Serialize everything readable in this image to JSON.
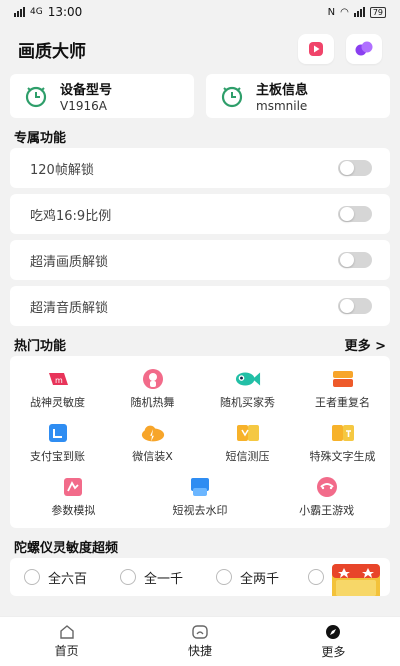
{
  "status_bar": {
    "carrier": "4G",
    "time": "13:00",
    "battery": "79"
  },
  "header": {
    "title": "画质大师"
  },
  "device_cards": [
    {
      "label": "设备型号",
      "value": "V1916A"
    },
    {
      "label": "主板信息",
      "value": "msmnile"
    }
  ],
  "exclusive": {
    "title": "专属功能",
    "items": [
      {
        "label": "120帧解锁",
        "enabled": false
      },
      {
        "label": "吃鸡16:9比例",
        "enabled": false
      },
      {
        "label": "超清画质解锁",
        "enabled": false
      },
      {
        "label": "超清音质解锁",
        "enabled": false
      }
    ]
  },
  "hot": {
    "title": "热门功能",
    "more": "更多 >",
    "items": [
      {
        "label": "战神灵敏度",
        "icon": "game-controller-icon"
      },
      {
        "label": "随机热舞",
        "icon": "dancer-icon"
      },
      {
        "label": "随机买家秀",
        "icon": "fish-icon"
      },
      {
        "label": "王者重复名",
        "icon": "tag-icon"
      },
      {
        "label": "支付宝到账",
        "icon": "alipay-icon"
      },
      {
        "label": "微信装X",
        "icon": "cloud-icon"
      },
      {
        "label": "短信测压",
        "icon": "message-icon"
      },
      {
        "label": "特殊文字生成",
        "icon": "text-gen-icon"
      },
      {
        "label": "参数模拟",
        "icon": "params-icon"
      },
      {
        "label": "短视去水印",
        "icon": "watermark-icon"
      },
      {
        "label": "小霸王游戏",
        "icon": "gamepad-icon"
      }
    ]
  },
  "gyro": {
    "title": "陀螺仪灵敏度超频",
    "options": [
      "全六百",
      "全一千",
      "全两千"
    ]
  },
  "bottom_nav": [
    {
      "label": "首页",
      "icon": "home-icon"
    },
    {
      "label": "快捷",
      "icon": "shortcut-icon"
    },
    {
      "label": "更多",
      "icon": "compass-icon"
    }
  ],
  "colors": {
    "accent_green": "#2e9e6a",
    "toggle_off": "#d6d6d6",
    "background": "#f2f2f2"
  }
}
